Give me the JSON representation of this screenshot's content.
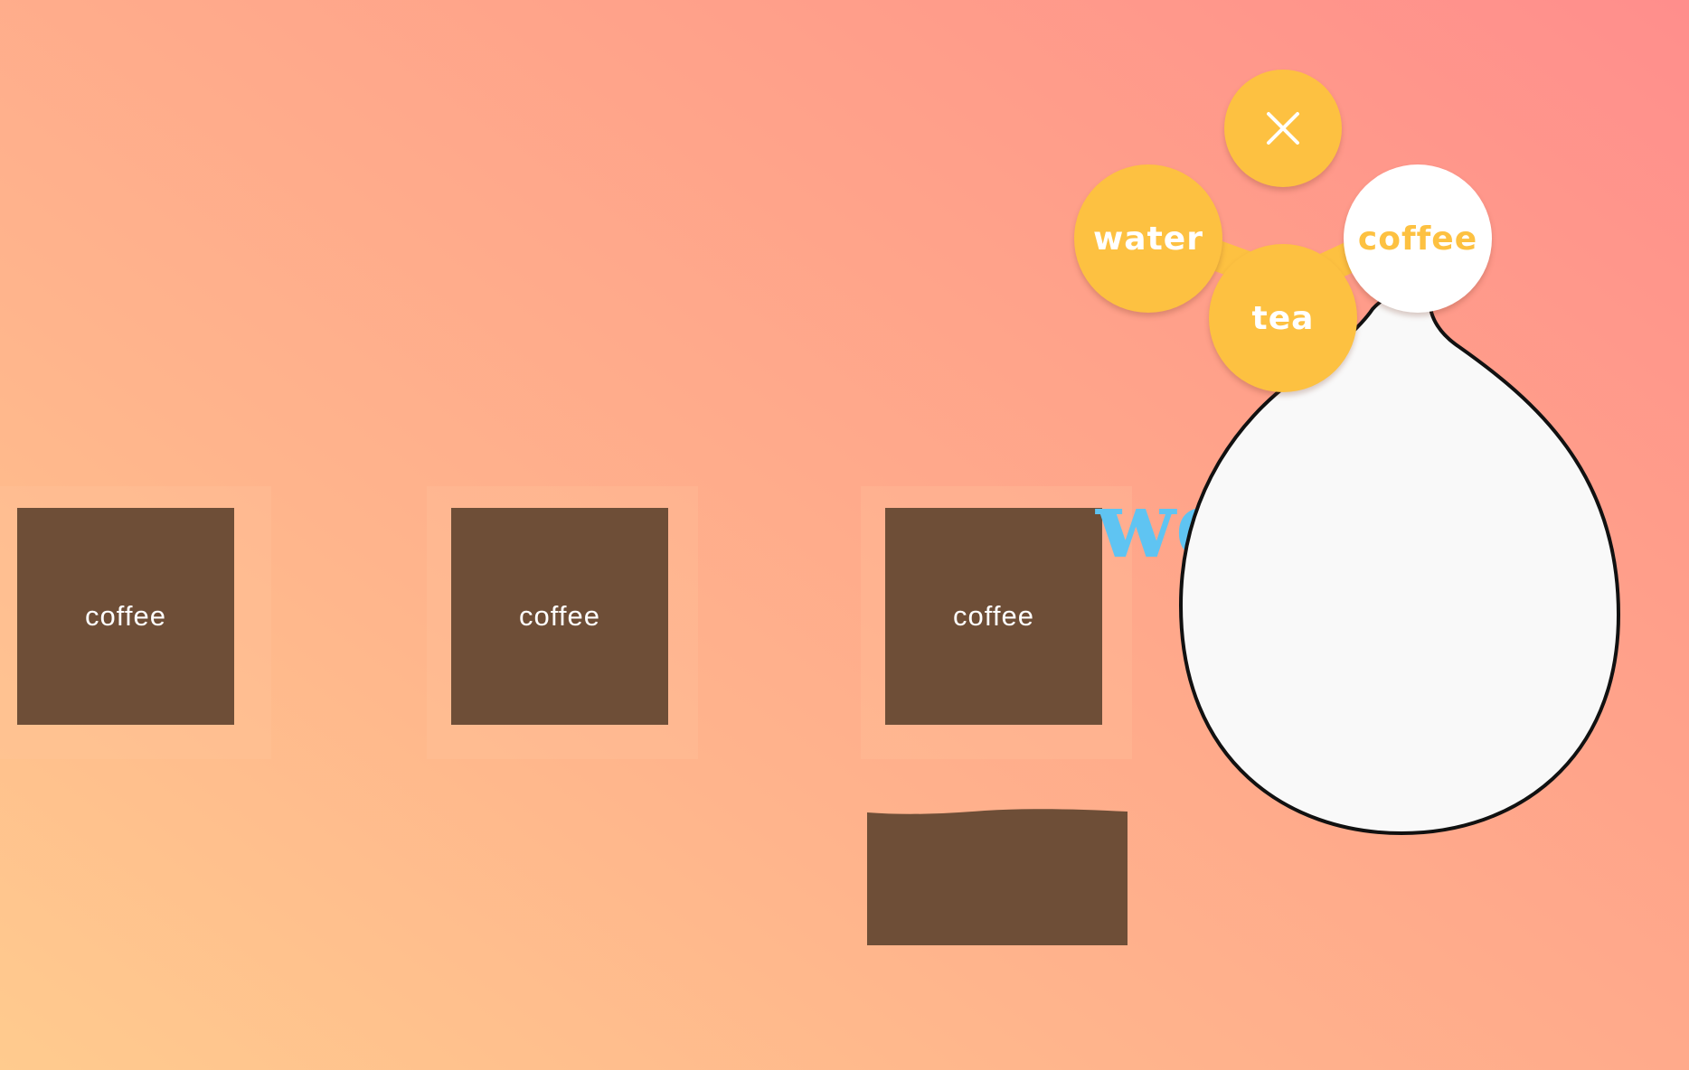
{
  "colors": {
    "tile": "#6e4e37",
    "menu_yellow": "#fdc141",
    "menu_active_bg": "#ffffff",
    "hidden_word": "#5fc4f2",
    "drop_fill": "#f9f9f9",
    "drop_stroke": "#111111"
  },
  "tiles": [
    {
      "label": "coffee"
    },
    {
      "label": "coffee"
    },
    {
      "label": "coffee"
    }
  ],
  "background_text": "we",
  "menu": {
    "close_icon": "close-icon",
    "items": [
      {
        "label": "water",
        "active": false
      },
      {
        "label": "tea",
        "active": false
      },
      {
        "label": "coffee",
        "active": true
      }
    ]
  }
}
